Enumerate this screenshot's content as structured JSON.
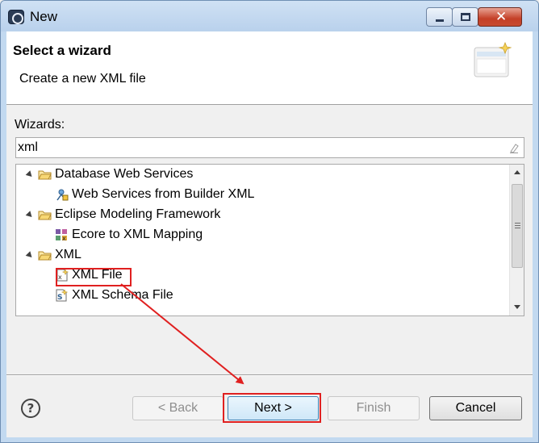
{
  "window": {
    "title": "New"
  },
  "header": {
    "title": "Select a wizard",
    "description": "Create a new XML file"
  },
  "wizards_label": "Wizards:",
  "filter": {
    "value": "xml"
  },
  "tree": {
    "items": [
      {
        "label": "Database Web Services",
        "level": 0,
        "expanded": true,
        "icon": "folder-icon"
      },
      {
        "label": "Web Services from Builder XML",
        "level": 1,
        "icon": "web-service-icon"
      },
      {
        "label": "Eclipse Modeling Framework",
        "level": 0,
        "expanded": true,
        "icon": "folder-icon"
      },
      {
        "label": "Ecore to XML Mapping",
        "level": 1,
        "icon": "ecore-mapping-icon"
      },
      {
        "label": "XML",
        "level": 0,
        "expanded": true,
        "icon": "folder-icon"
      },
      {
        "label": "XML File",
        "level": 1,
        "icon": "xml-file-icon",
        "selected": true
      },
      {
        "label": "XML Schema File",
        "level": 1,
        "icon": "xml-schema-icon"
      }
    ]
  },
  "buttons": {
    "back": "< Back",
    "next": "Next >",
    "finish": "Finish",
    "cancel": "Cancel"
  },
  "colors": {
    "annotation": "#e02020",
    "titlebar": "#c2d9f0",
    "close_button": "#c43f27"
  }
}
